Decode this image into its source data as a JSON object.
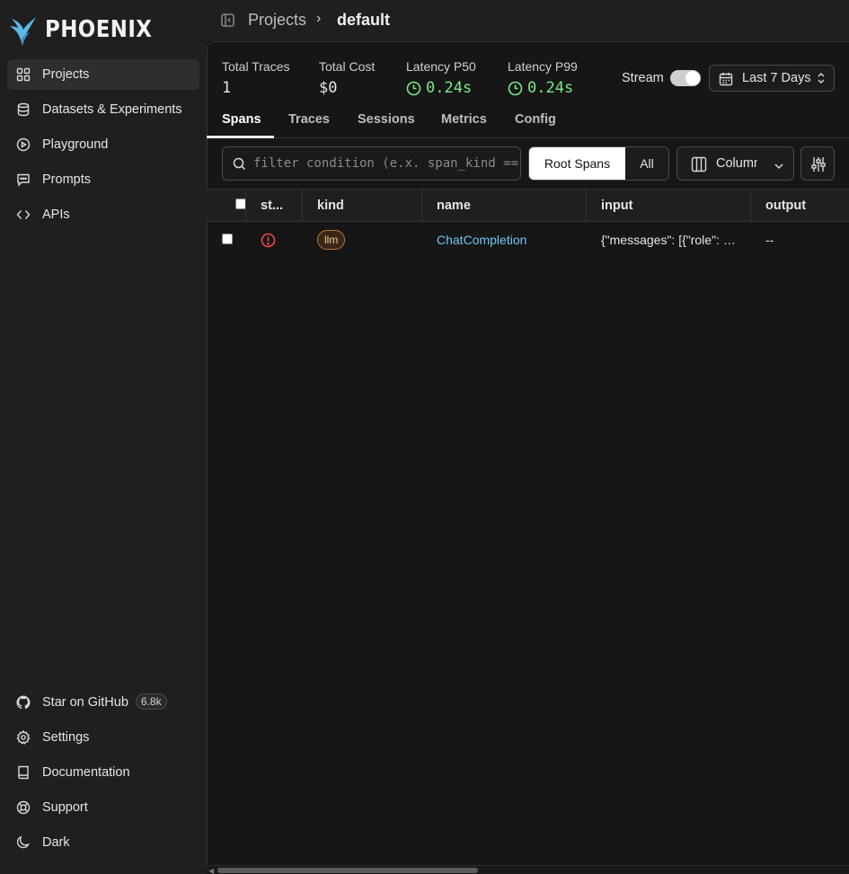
{
  "app": {
    "logo_text": "PHOENIX"
  },
  "sidebar": {
    "nav": [
      {
        "label": "Projects",
        "icon": "grid-icon",
        "active": true
      },
      {
        "label": "Datasets & Experiments",
        "icon": "database-icon"
      },
      {
        "label": "Playground",
        "icon": "play-circle-icon"
      },
      {
        "label": "Prompts",
        "icon": "message-square-icon"
      },
      {
        "label": "APIs",
        "icon": "code-icon"
      }
    ],
    "footer": [
      {
        "label": "Star on GitHub",
        "icon": "github-icon",
        "badge": "6.8k"
      },
      {
        "label": "Settings",
        "icon": "gear-icon"
      },
      {
        "label": "Documentation",
        "icon": "book-icon"
      },
      {
        "label": "Support",
        "icon": "lifebuoy-icon"
      },
      {
        "label": "Dark",
        "icon": "moon-icon"
      }
    ]
  },
  "breadcrumb": {
    "parent": "Projects",
    "separator": "›",
    "current": "default"
  },
  "stats": {
    "total_traces": {
      "label": "Total Traces",
      "value": "1"
    },
    "total_cost": {
      "label": "Total Cost",
      "value": "$0"
    },
    "latency_p50": {
      "label": "Latency P50",
      "value": "0.24s"
    },
    "latency_p99": {
      "label": "Latency P99",
      "value": "0.24s"
    }
  },
  "stream": {
    "label": "Stream",
    "on": true
  },
  "date_range": {
    "label": "Last 7 Days"
  },
  "tabs": [
    "Spans",
    "Traces",
    "Sessions",
    "Metrics",
    "Config"
  ],
  "active_tab": "Spans",
  "filter": {
    "placeholder": "filter condition (e.x. span_kind == 'LLM')",
    "value": ""
  },
  "span_toggle": {
    "root_label": "Root Spans",
    "all_label": "All",
    "selected": "Root Spans"
  },
  "columns_button": {
    "label": "Columns"
  },
  "table": {
    "headers": {
      "status": "st...",
      "kind": "kind",
      "name": "name",
      "input": "input",
      "output": "output"
    },
    "rows": [
      {
        "status": "error",
        "kind": "llm",
        "name": "ChatCompletion",
        "input": "{\"messages\": [{\"role\": \"system\", \"content\": ...",
        "output": "--"
      }
    ]
  },
  "colors": {
    "accent_latency": "#7ee787",
    "link": "#72c5f0",
    "error": "#f0484c",
    "kind_badge_border": "#b5773a"
  }
}
